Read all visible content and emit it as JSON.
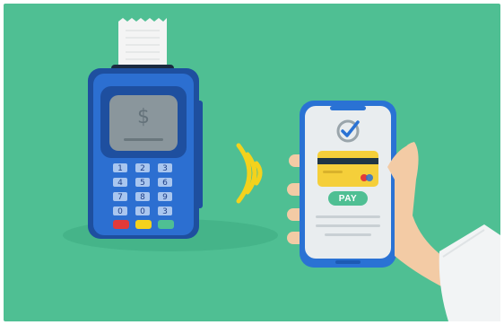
{
  "colors": {
    "background": "#4fbf93",
    "background_dark": "#3fae84",
    "terminal_body": "#2c6fd1",
    "terminal_dark": "#1e4f9f",
    "terminal_screen": "#8a969c",
    "receipt_paper": "#f4f4f4",
    "nfc_wave": "#f4d21c",
    "phone_body": "#2a72d4",
    "phone_screen": "#e9edef",
    "card": "#f5cf3a",
    "card_stripe": "#1f3545",
    "pay_button": "#4fbf93",
    "hand_skin": "#f3cba5",
    "sleeve": "#f2f4f5",
    "key_red": "#e23a3a",
    "key_yellow": "#f4d21c",
    "key_green": "#4fbf93"
  },
  "terminal": {
    "screen_symbol": "$",
    "keys": [
      "1",
      "2",
      "3",
      "4",
      "5",
      "6",
      "7",
      "8",
      "9",
      "0",
      "0",
      "3"
    ]
  },
  "phone": {
    "pay_label": "PAY"
  },
  "icons": {
    "check": "check-circle-icon",
    "nfc": "contactless-waves-icon"
  }
}
